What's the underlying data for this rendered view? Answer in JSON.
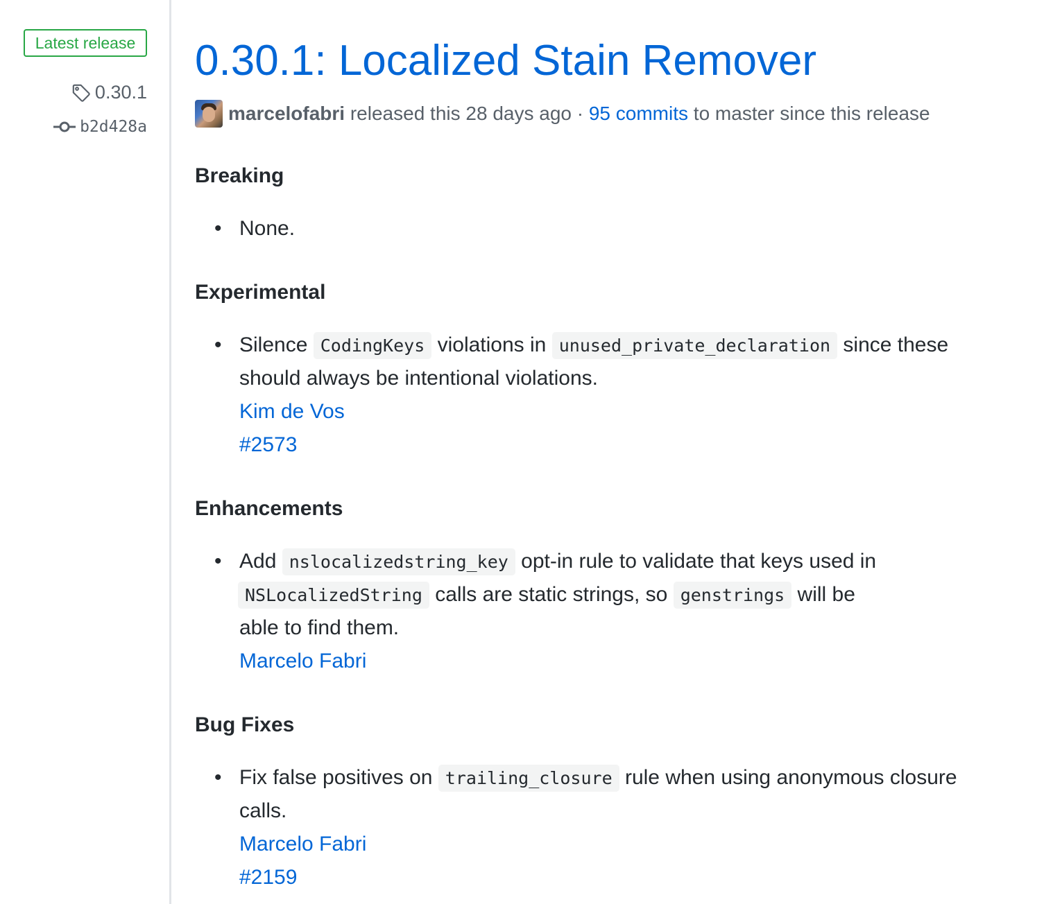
{
  "sidebar": {
    "badge": "Latest release",
    "tag": "0.30.1",
    "commit": "b2d428a"
  },
  "release": {
    "title": "0.30.1: Localized Stain Remover",
    "author": "marcelofabri",
    "released_text": "released this 28 days ago",
    "separator": "·",
    "commits_link": "95 commits",
    "commits_suffix": "to master since this release"
  },
  "sections": {
    "breaking": {
      "heading": "Breaking",
      "item": "None."
    },
    "experimental": {
      "heading": "Experimental",
      "text1": "Silence",
      "code1": "CodingKeys",
      "text2": "violations in",
      "code2": "unused_private_declaration",
      "text3": "since these",
      "text4": "should always be intentional violations.",
      "author_link": "Kim de Vos",
      "issue_link": "#2573"
    },
    "enhancements": {
      "heading": "Enhancements",
      "text1": "Add",
      "code1": "nslocalizedstring_key",
      "text2": "opt-in rule to validate that keys used in",
      "code2": "NSLocalizedString",
      "text3": "calls are static strings, so",
      "code3": "genstrings",
      "text4": "will be",
      "text5": "able to find them.",
      "author_link": "Marcelo Fabri"
    },
    "bug_fixes": {
      "heading": "Bug Fixes",
      "text1": "Fix false positives on",
      "code1": "trailing_closure",
      "text2": "rule when using anonymous closure",
      "text3": "calls.",
      "author_link": "Marcelo Fabri",
      "issue_link": "#2159"
    }
  },
  "icons": {
    "tag": "tag-icon",
    "commit": "git-commit-icon"
  },
  "colors": {
    "link": "#0366d6",
    "badge": "#28a745",
    "muted": "#586069",
    "text": "#24292e"
  }
}
